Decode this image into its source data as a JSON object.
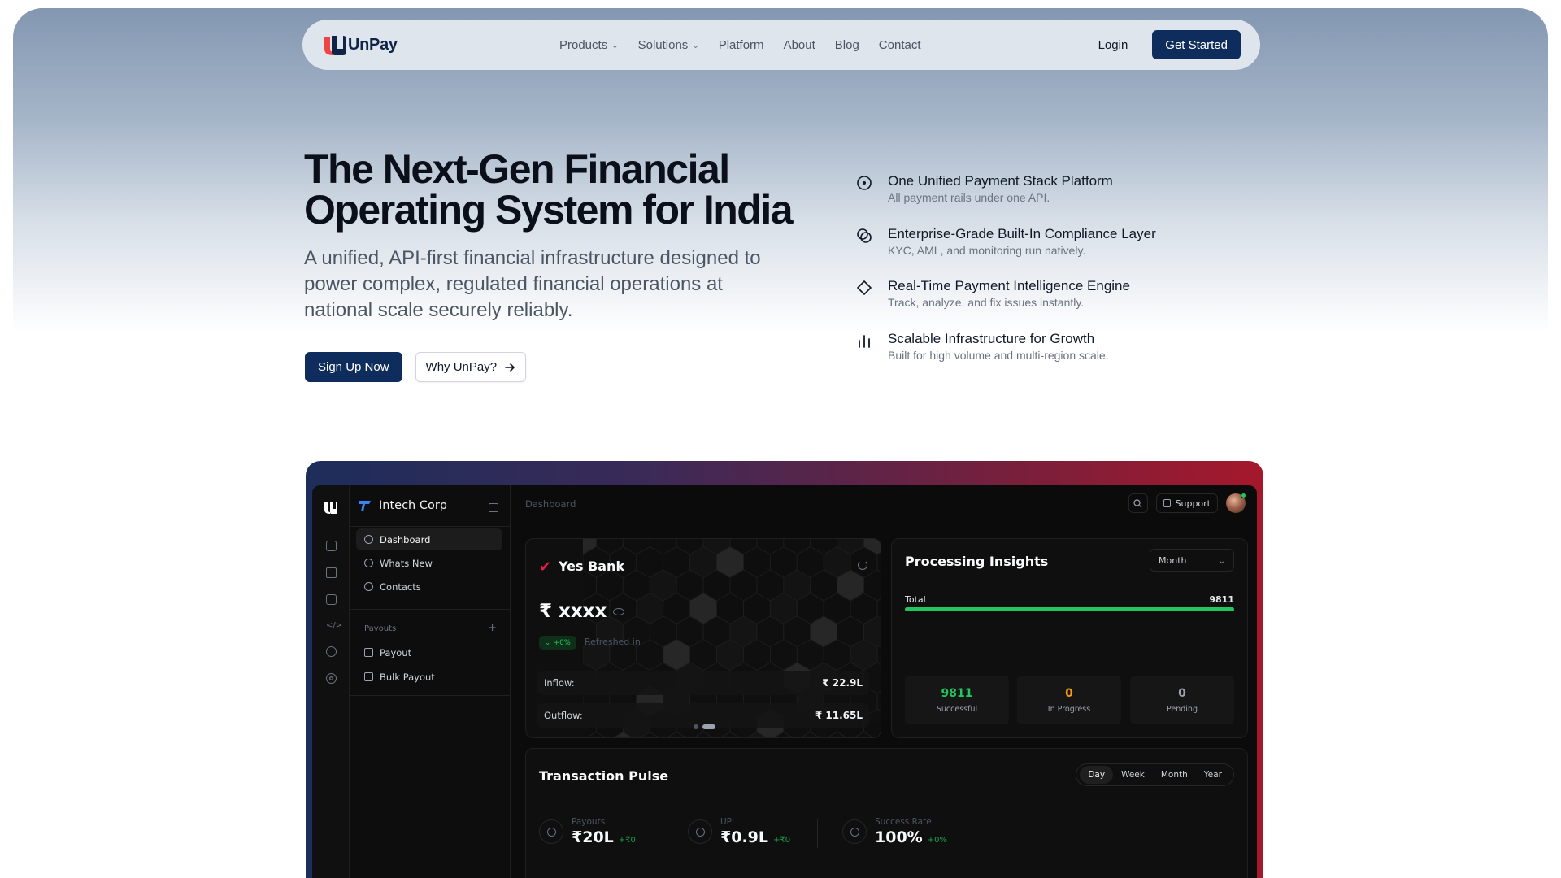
{
  "nav": {
    "logo_text": "UnPay",
    "links": [
      {
        "label": "Products",
        "dropdown": true
      },
      {
        "label": "Solutions",
        "dropdown": true
      },
      {
        "label": "Platform",
        "dropdown": false
      },
      {
        "label": "About",
        "dropdown": false
      },
      {
        "label": "Blog",
        "dropdown": false
      },
      {
        "label": "Contact",
        "dropdown": false
      }
    ],
    "login_label": "Login",
    "cta_label": "Get Started"
  },
  "hero": {
    "title": "The Next-Gen Financial Operating System for India",
    "subtitle": "A unified, API-first financial infrastructure designed to power complex, regulated financial operations at national scale securely reliably.",
    "signup_label": "Sign Up Now",
    "why_label": "Why UnPay?"
  },
  "features": [
    {
      "icon": "target-icon",
      "title": "One Unified Payment Stack Platform",
      "desc": "All payment rails under one API."
    },
    {
      "icon": "shield-badge-icon",
      "title": "Enterprise-Grade Built-In Compliance Layer",
      "desc": "KYC, AML, and monitoring run natively."
    },
    {
      "icon": "diamond-icon",
      "title": "Real-Time Payment Intelligence Engine",
      "desc": "Track, analyze, and fix issues instantly."
    },
    {
      "icon": "bar-chart-icon",
      "title": "Scalable Infrastructure for Growth",
      "desc": "Built for high volume and multi-region scale."
    }
  ],
  "dashboard": {
    "company": "Intech Corp",
    "breadcrumb": "Dashboard",
    "support_label": "Support",
    "sidebar": {
      "items": [
        "Dashboard",
        "Whats New",
        "Contacts"
      ],
      "section": "Payouts",
      "payout_items": [
        "Payout",
        "Bulk Payout"
      ]
    },
    "bank": {
      "name": "Yes Bank",
      "balance": "₹ xxxx",
      "change": "+0%",
      "refreshed": "Refreshed in",
      "inflow_label": "Inflow:",
      "inflow_value": "₹ 22.9L",
      "outflow_label": "Outflow:",
      "outflow_value": "₹ 11.65L"
    },
    "insights": {
      "title": "Processing Insights",
      "period": "Month",
      "total_label": "Total",
      "total_value": "9811",
      "progress_fraction": 1.0,
      "stats": [
        {
          "value": "9811",
          "label": "Successful",
          "color": "#22c55e"
        },
        {
          "value": "0",
          "label": "In Progress",
          "color": "#f59e0b"
        },
        {
          "value": "0",
          "label": "Pending",
          "color": "#9ca3af"
        }
      ]
    },
    "pulse": {
      "title": "Transaction Pulse",
      "periods": [
        "Day",
        "Week",
        "Month",
        "Year"
      ],
      "active_period": "Day",
      "metrics": [
        {
          "label": "Payouts",
          "value": "₹20L",
          "change": "+₹0"
        },
        {
          "label": "UPI",
          "value": "₹0.9L",
          "change": "+₹0"
        },
        {
          "label": "Success Rate",
          "value": "100%",
          "change": "+0%"
        }
      ]
    }
  },
  "colors": {
    "brand_navy": "#0f2d5c",
    "success_green": "#22c55e",
    "warning_amber": "#f59e0b"
  }
}
